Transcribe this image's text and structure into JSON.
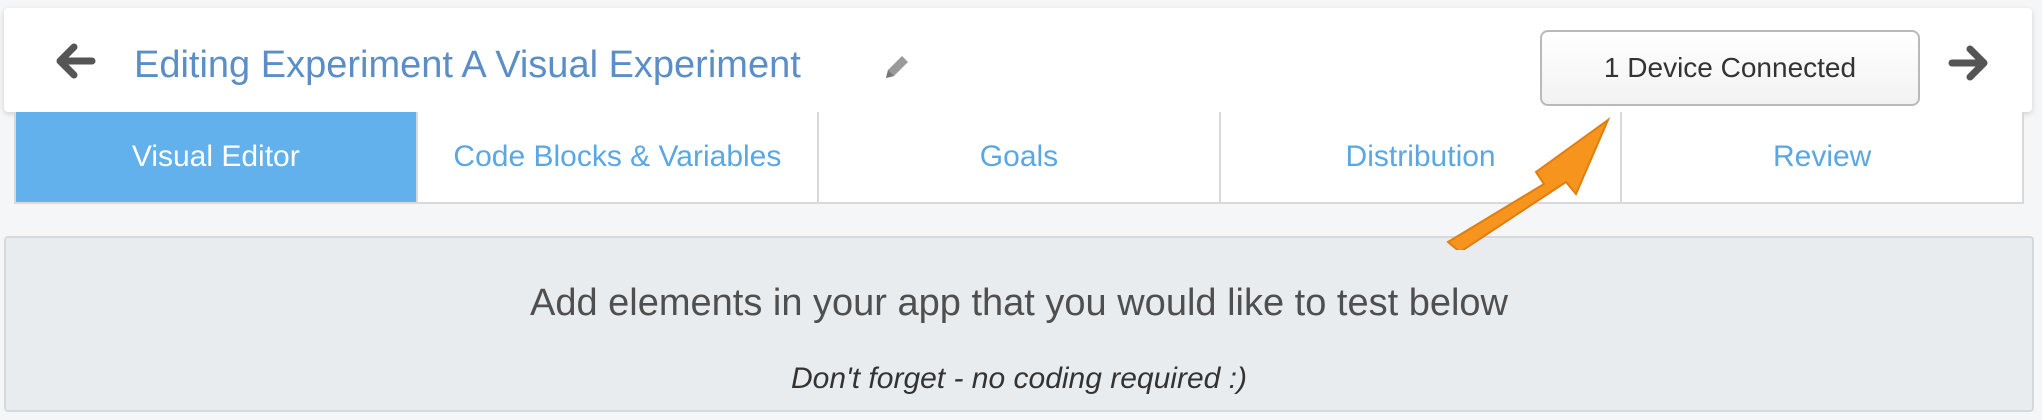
{
  "header": {
    "title": "Editing Experiment A Visual Experiment",
    "back_icon": "arrow-left-icon",
    "forward_icon": "arrow-right-icon",
    "edit_icon": "pencil-icon",
    "device_button_label": "1 Device Connected"
  },
  "tabs": [
    {
      "label": "Visual Editor",
      "active": true
    },
    {
      "label": "Code Blocks & Variables",
      "active": false
    },
    {
      "label": "Goals",
      "active": false
    },
    {
      "label": "Distribution",
      "active": false
    },
    {
      "label": "Review",
      "active": false
    }
  ],
  "panel": {
    "heading": "Add elements in your app that you would like to test below",
    "subtext": "Don't forget - no coding required :)"
  },
  "annotation": {
    "icon": "orange-arrow-icon",
    "color": "#f7941d"
  },
  "colors": {
    "title": "#5b8ec7",
    "active_tab_bg": "#62b1ec",
    "tab_text": "#5aa7e4"
  }
}
